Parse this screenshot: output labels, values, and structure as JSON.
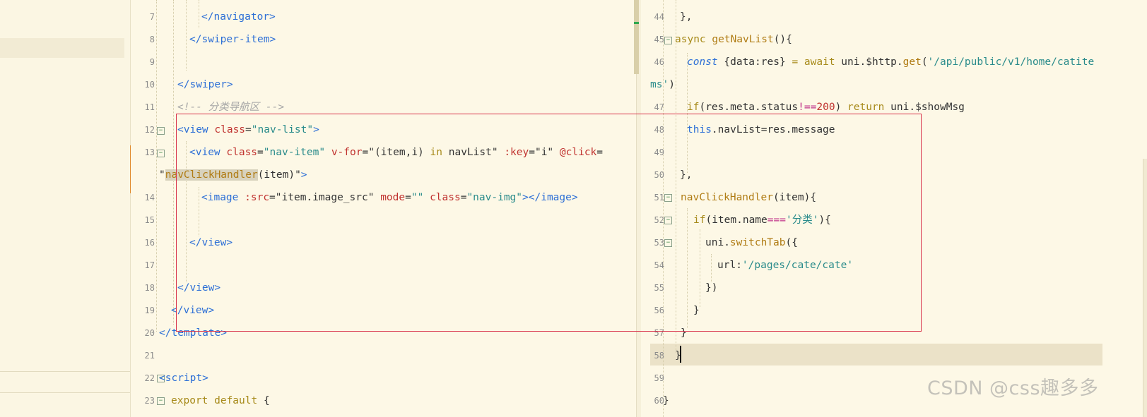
{
  "left_editor": {
    "line_numbers": [
      "7",
      "8",
      "9",
      "10",
      "11",
      "12",
      "13",
      "14",
      "15",
      "16",
      "17",
      "18",
      "19",
      "20",
      "21",
      "22",
      "23"
    ],
    "lines": {
      "l7": "</navigator>",
      "l8": "</swiper-item>",
      "l10": "</swiper>",
      "l11": "<!-- 分类导航区 -->",
      "l12_open": "<view",
      "l12_attr": "class",
      "l12_eq": "=",
      "l12_val": "\"nav-list\"",
      "l12_close": ">",
      "l13_open": "<view",
      "l13_attr1": "class",
      "l13_val1": "\"nav-item\"",
      "l13_attr2": "v-for",
      "l13_val2a": "\"(item,i)",
      "l13_in": "in",
      "l13_val2b": "navList\"",
      "l13_attr3": ":key",
      "l13_val3": "\"i\"",
      "l13_attr4": "@click",
      "l13b_q": "\"",
      "l13b_handler": "navClickHandler",
      "l13b_rest": "(item)\"",
      "l13b_close": ">",
      "l14_open": "<image",
      "l14_attr1": ":src",
      "l14_val1": "\"item.image_src\"",
      "l14_attr2": "mode",
      "l14_val2": "\"\"",
      "l14_attr3": "class",
      "l14_val3": "\"nav-img\"",
      "l14_close": "></image>",
      "l16": "</view>",
      "l18": "</view>",
      "l19": "</view>",
      "l20": "</template>",
      "l22": "<script>",
      "l23_kw": "export default",
      "l23_brace": "{"
    }
  },
  "right_editor": {
    "line_numbers": [
      "44",
      "45",
      "46",
      "",
      "47",
      "48",
      "49",
      "50",
      "51",
      "52",
      "53",
      "54",
      "55",
      "56",
      "57",
      "58",
      "59",
      "60"
    ],
    "lines": {
      "r44": "},",
      "r45_kw": "async",
      "r45_fn": "getNavList",
      "r45_rest": "(){",
      "r46_kw": "const",
      "r46_a": "{data:res}",
      "r46_eq": "=",
      "r46_await": "await",
      "r46_b": "uni.$http.",
      "r46_get": "get",
      "r46_c": "(",
      "r46_str": "'/api/public/v1/home/catite",
      "r46b_str": "ms'",
      "r46b_c": ")",
      "r47_if": "if",
      "r47_a": "(res.meta.status",
      "r47_op": "!==",
      "r47_num": "200",
      "r47_b": ")",
      "r47_ret": "return",
      "r47_c": "uni.$showMsg",
      "r48_this": "this",
      "r48_rest": ".navList=res.message",
      "r50": "},",
      "r51_fn": "navClickHandler",
      "r51_rest": "(item){",
      "r52_if": "if",
      "r52_a": "(item.name",
      "r52_op": "===",
      "r52_str": "'分类'",
      "r52_b": "){",
      "r53_a": "uni.",
      "r53_fn": "switchTab",
      "r53_b": "({",
      "r54_a": "url:",
      "r54_str": "'/pages/cate/cate'",
      "r55": "})",
      "r56": "}",
      "r57": "}",
      "r58": "}",
      "r60": "}"
    }
  },
  "watermark": "CSDN @css趣多多",
  "colors": {
    "background": "#fdf8e6",
    "tag": "#2d6fd6",
    "attribute": "#c0322f",
    "string": "#2a8b8b",
    "keyword": "#a78a1a",
    "annotation_box": "#d8314a"
  }
}
